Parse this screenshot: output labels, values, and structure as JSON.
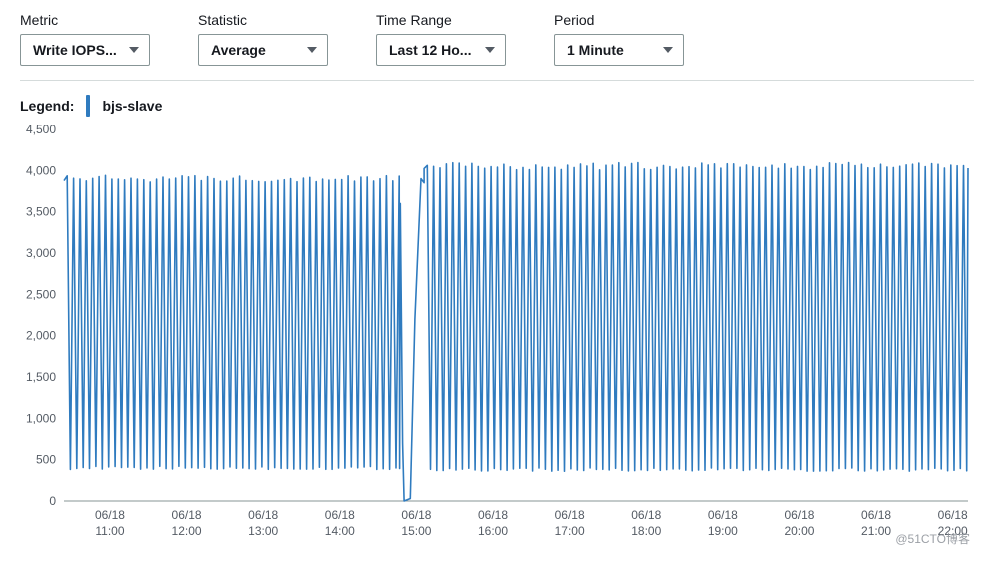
{
  "controls": {
    "metric": {
      "label": "Metric",
      "value": "Write IOPS..."
    },
    "statistic": {
      "label": "Statistic",
      "value": "Average"
    },
    "timerange": {
      "label": "Time Range",
      "value": "Last 12 Ho..."
    },
    "period": {
      "label": "Period",
      "value": "1 Minute"
    }
  },
  "legend": {
    "label": "Legend:",
    "series": "bjs-slave"
  },
  "watermark": "@51CTO博客",
  "chart_data": {
    "type": "line",
    "title": "",
    "xlabel": "",
    "ylabel": "",
    "ylim": [
      0,
      4500
    ],
    "yticks": [
      0,
      500,
      1000,
      1500,
      2000,
      2500,
      3000,
      3500,
      4000,
      4500
    ],
    "x_start_hour": 10.4,
    "x_end_hour": 22.2,
    "xticks": [
      {
        "hour": 11,
        "top": "06/18",
        "bottom": "11:00"
      },
      {
        "hour": 12,
        "top": "06/18",
        "bottom": "12:00"
      },
      {
        "hour": 13,
        "top": "06/18",
        "bottom": "13:00"
      },
      {
        "hour": 14,
        "top": "06/18",
        "bottom": "14:00"
      },
      {
        "hour": 15,
        "top": "06/18",
        "bottom": "15:00"
      },
      {
        "hour": 16,
        "top": "06/18",
        "bottom": "16:00"
      },
      {
        "hour": 17,
        "top": "06/18",
        "bottom": "17:00"
      },
      {
        "hour": 18,
        "top": "06/18",
        "bottom": "18:00"
      },
      {
        "hour": 19,
        "top": "06/18",
        "bottom": "19:00"
      },
      {
        "hour": 20,
        "top": "06/18",
        "bottom": "20:00"
      },
      {
        "hour": 21,
        "top": "06/18",
        "bottom": "21:00"
      },
      {
        "hour": 22,
        "top": "06/18",
        "bottom": "22:00"
      }
    ],
    "series": [
      {
        "name": "bjs-slave",
        "color": "#2f7bbf"
      }
    ],
    "segments": [
      {
        "from_hour": 10.4,
        "to_hour": 14.78,
        "peak": 3900,
        "trough": 400,
        "peak_jitter": 80,
        "trough_jitter": 40,
        "period_min": 5
      },
      {
        "from_hour": 15.1,
        "to_hour": 22.2,
        "peak": 4050,
        "trough": 380,
        "peak_jitter": 90,
        "trough_jitter": 40,
        "period_min": 5
      }
    ],
    "gap": {
      "from_hour": 14.78,
      "to_hour": 15.1,
      "min_value": 0,
      "rise_peak": 3900
    }
  }
}
